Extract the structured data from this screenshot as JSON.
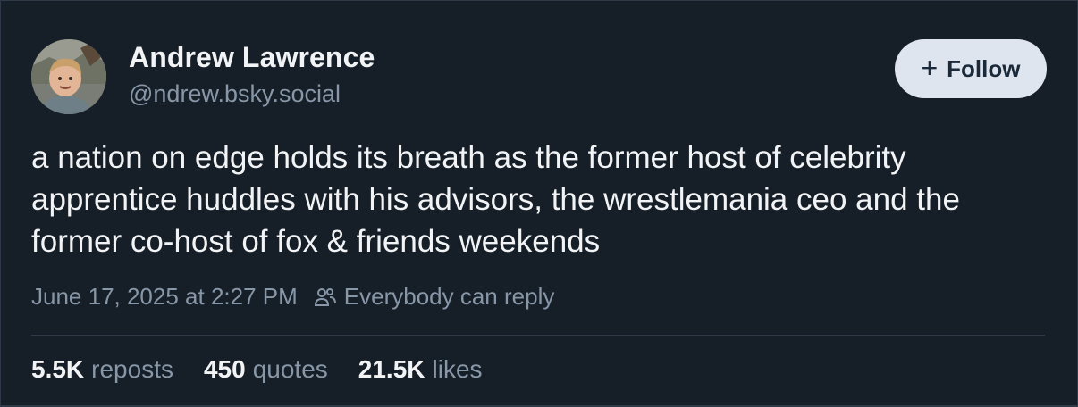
{
  "author": {
    "display_name": "Andrew Lawrence",
    "handle": "@ndrew.bsky.social",
    "avatar_icon": "child-photo-avatar"
  },
  "follow_button": {
    "icon": "plus-icon",
    "label": "Follow"
  },
  "post": {
    "text": "a nation on edge holds its breath as the former host of celebrity apprentice huddles with his advisors, the wrestlemania ceo and the former co-host of fox & friends weekends",
    "timestamp": "June 17, 2025 at 2:27 PM",
    "reply_setting_icon": "people-icon",
    "reply_setting": "Everybody can reply"
  },
  "stats": {
    "reposts": {
      "value": "5.5K",
      "label": "reposts"
    },
    "quotes": {
      "value": "450",
      "label": "quotes"
    },
    "likes": {
      "value": "21.5K",
      "label": "likes"
    }
  },
  "colors": {
    "background": "#161e27",
    "text_primary": "#f1f3f5",
    "text_secondary": "#8797a8",
    "follow_bg": "#dfe5ee",
    "border": "#2e3a47"
  }
}
